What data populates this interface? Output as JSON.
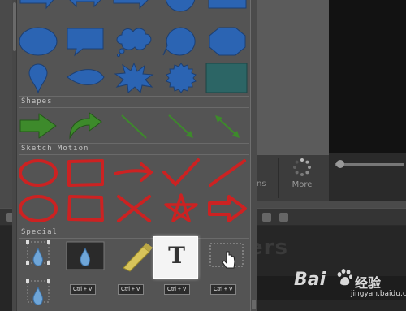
{
  "background": {
    "more_button_label": "More",
    "tab_fragment": "ns",
    "faded_timeline_text": "ers"
  },
  "watermark": {
    "logo": "Bai",
    "jingyan": "经验",
    "url": "jingyan.baidu.com"
  },
  "panel": {
    "sections": {
      "shapes": "Shapes",
      "sketch_motion": "Sketch Motion",
      "special": "Special"
    },
    "special_tiles": {
      "text_glyph": "T",
      "keycap_label": "Ctrl + V"
    }
  },
  "colors": {
    "blue_shape": "#2b64b3",
    "teal_square": "#2c6565",
    "green_arrow": "#3d8a2b",
    "red_sketch": "#cc2222",
    "panel_bg": "#545454"
  },
  "icons": {
    "more": "dotted-circle-icon",
    "cursor": "hand-pointer-icon",
    "keyboard": "keycap-icon"
  }
}
